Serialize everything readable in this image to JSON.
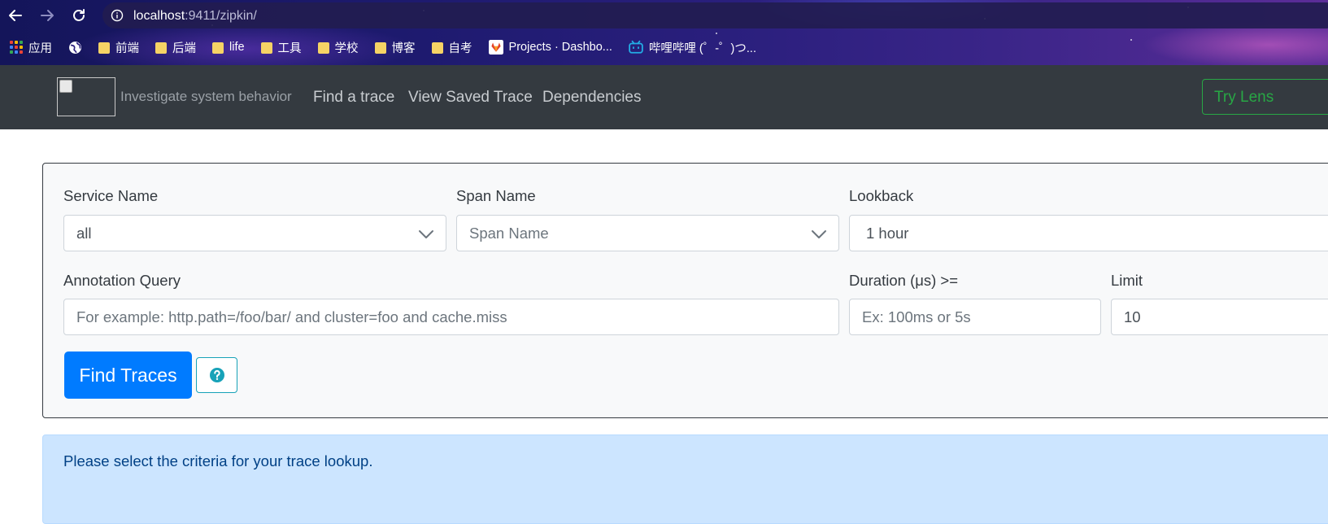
{
  "browser": {
    "url_host": "localhost",
    "url_rest": ":9411/zipkin/",
    "bookmarks": [
      {
        "label": "应用",
        "icon": "apps-icon"
      },
      {
        "label": "",
        "icon": "globe-icon"
      },
      {
        "label": "前端",
        "icon": "folder-icon"
      },
      {
        "label": "后端",
        "icon": "folder-icon"
      },
      {
        "label": "life",
        "icon": "folder-icon"
      },
      {
        "label": "工具",
        "icon": "folder-icon"
      },
      {
        "label": "学校",
        "icon": "folder-icon"
      },
      {
        "label": "博客",
        "icon": "folder-icon"
      },
      {
        "label": "自考",
        "icon": "folder-icon"
      },
      {
        "label": "Projects · Dashbo...",
        "icon": "gitlab-icon"
      },
      {
        "label": "哔哩哔哩 (゜-゜)つ...",
        "icon": "bilibili-icon"
      }
    ]
  },
  "navbar": {
    "tagline": "Investigate system behavior",
    "links": [
      "Find a trace",
      "View Saved Trace",
      "Dependencies"
    ],
    "try_lens": "Try Lens"
  },
  "search": {
    "service_label": "Service Name",
    "service_value": "all",
    "span_label": "Span Name",
    "span_placeholder": "Span Name",
    "lookback_label": "Lookback",
    "lookback_value": "1 hour",
    "annotation_label": "Annotation Query",
    "annotation_placeholder": "For example: http.path=/foo/bar/ and cluster=foo and cache.miss",
    "duration_label": "Duration (μs) >=",
    "duration_placeholder": "Ex: 100ms or 5s",
    "limit_label": "Limit",
    "limit_value": "10",
    "find_button": "Find Traces"
  },
  "alert": {
    "message": "Please select the criteria for your trace lookup."
  },
  "colors": {
    "primary": "#007bff",
    "navbar_bg": "#343a40",
    "lens_green": "#28a745",
    "info_teal": "#17a2b8",
    "alert_bg": "#cce5ff"
  }
}
